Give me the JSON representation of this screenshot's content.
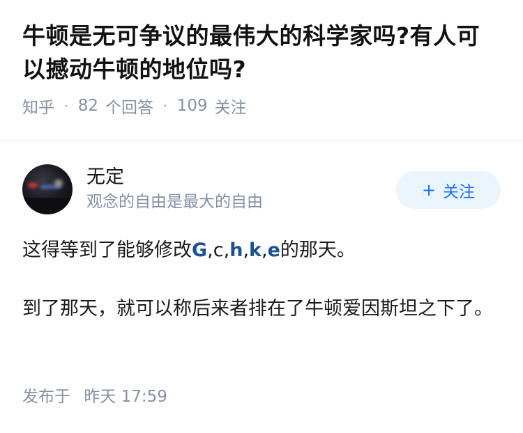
{
  "question": {
    "title": "牛顿是无可争议的最伟大的科学家吗?有人可以撼动牛顿的地位吗?",
    "source": "知乎",
    "answers_count": "82",
    "answers_label": "个回答",
    "followers_count": "109",
    "followers_label": "关注"
  },
  "answer": {
    "author": {
      "name": "无定",
      "bio": "观念的自由是最大的自由"
    },
    "follow_button": {
      "plus": "+",
      "label": "关注"
    },
    "paragraph1": {
      "prefix": "这得等到了能够修改",
      "t1": "G",
      "s1": ",",
      "t2": "c",
      "s2": ",",
      "t3": "h",
      "s3": ",",
      "t4": "k",
      "s4": ",",
      "t5": "e",
      "suffix": "的那天。"
    },
    "paragraph2": "到了那天，就可以称后来者排在了牛顿爱因斯坦之下了。",
    "publish": {
      "label": "发布于",
      "time": "昨天 17:59"
    }
  },
  "colors": {
    "link_blue": "#175199",
    "follow_blue": "#1772f6",
    "follow_bg": "#ebf5fd",
    "meta_gray": "#8590a6"
  }
}
